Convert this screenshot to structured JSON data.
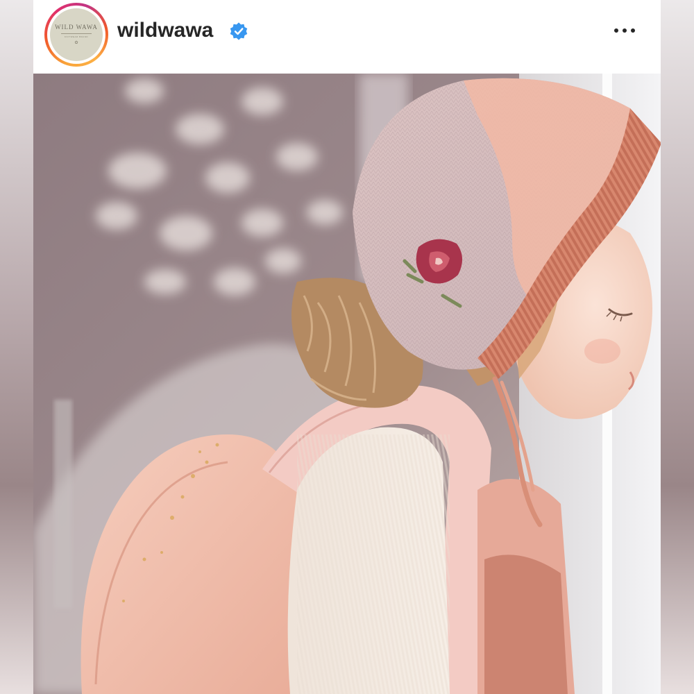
{
  "post": {
    "username": "wildwawa",
    "verified": true,
    "more_icon": "more-horizontal-icon",
    "avatar": {
      "brand_text": "WILD WAWA",
      "sub_text": "KNITWEAR BRAND",
      "mark": "✿"
    },
    "image_alt": "Toddler wearing a pink knitted bonnet with a rose motif and a pink backpack, looking out a window"
  },
  "colors": {
    "story_ring_start": "#f9a43a",
    "story_ring_end": "#c13584",
    "verified_blue": "#3897f0",
    "text_primary": "#262626"
  }
}
